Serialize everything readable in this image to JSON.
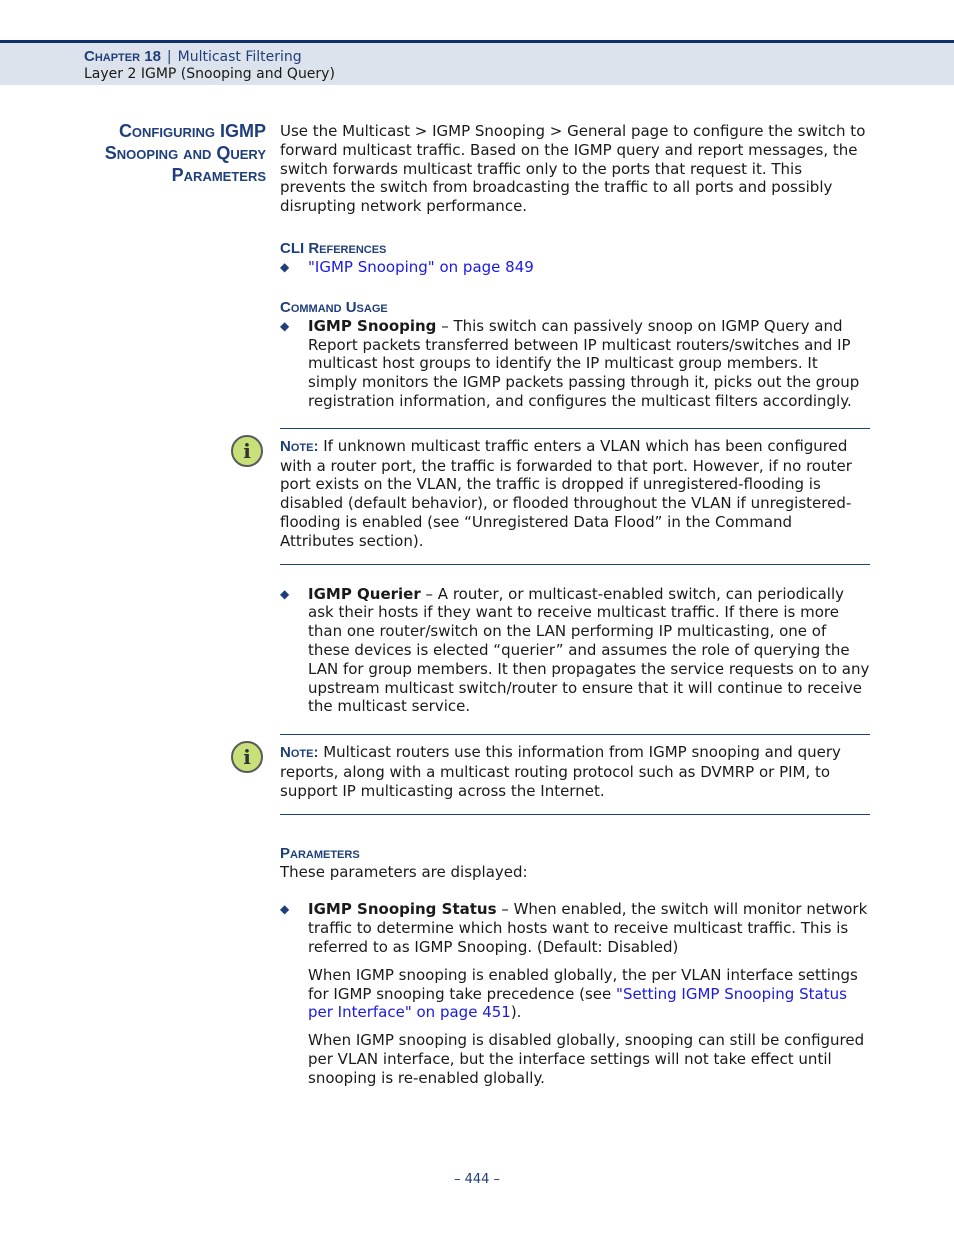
{
  "header": {
    "chapter_label": "Chapter 18",
    "separator": "|",
    "chapter_title": "Multicast Filtering",
    "section": "Layer 2 IGMP (Snooping and Query)"
  },
  "side_heading": {
    "line1": "Configuring IGMP",
    "line2": "Snooping and Query",
    "line3": "Parameters"
  },
  "intro": "Use the Multicast > IGMP Snooping > General page to configure the switch to forward multicast traffic. Based on the IGMP query and report messages, the switch forwards multicast traffic only to the ports that request it. This prevents the switch from broadcasting the traffic to all ports and possibly disrupting network performance.",
  "cli_references": {
    "heading": "CLI References",
    "items": [
      {
        "link": "\"IGMP Snooping\" on page 849"
      }
    ]
  },
  "command_usage": {
    "heading": "Command Usage",
    "bullet1": {
      "term": "IGMP Snooping",
      "text": " – This switch can passively snoop on IGMP Query and Report packets transferred between IP multicast routers/switches and IP multicast host groups to identify the IP multicast group members. It simply monitors the IGMP packets passing through it, picks out the group registration information, and configures the multicast filters accordingly."
    },
    "note1": {
      "label": "Note:",
      "text": " If unknown multicast traffic enters a VLAN which has been configured with a router port, the traffic is forwarded to that port. However, if no router port exists on the VLAN, the traffic is dropped if unregistered-flooding is disabled (default behavior), or flooded throughout the VLAN if unregistered-flooding is enabled (see “Unregistered Data Flood” in the Command Attributes section)."
    },
    "bullet2": {
      "term": "IGMP Querier",
      "text": " – A router, or multicast-enabled switch, can periodically ask their hosts if they want to receive multicast traffic. If there is more than one router/switch on the LAN performing IP multicasting, one of these devices is elected “querier” and assumes the role of querying the LAN for group members. It then propagates the service requests on to any upstream multicast switch/router to ensure that it will continue to receive the multicast service."
    },
    "note2": {
      "label": "Note:",
      "text": " Multicast routers use this information from IGMP snooping and query reports, along with a multicast routing protocol such as DVMRP or PIM, to support IP multicasting across the Internet."
    }
  },
  "parameters": {
    "heading": "Parameters",
    "intro": "These parameters are displayed:",
    "bullet1": {
      "term": "IGMP Snooping Status",
      "text": " – When enabled, the switch will monitor network traffic to determine which hosts want to receive multicast traffic. This is referred to as IGMP Snooping. (Default: Disabled)"
    },
    "para1_before": "When IGMP snooping is enabled globally, the per VLAN interface settings for IGMP snooping take precedence (see ",
    "para1_link": "\"Setting IGMP Snooping Status per Interface\" on page 451",
    "para1_after": ").",
    "para2": "When IGMP snooping is disabled globally, snooping can still be configured per VLAN interface, but the interface settings will not take effect until snooping is re-enabled globally."
  },
  "icons": {
    "bullet": "diamond-bullet",
    "note": "info-icon"
  },
  "footer": {
    "page_number": "–  444  –"
  }
}
